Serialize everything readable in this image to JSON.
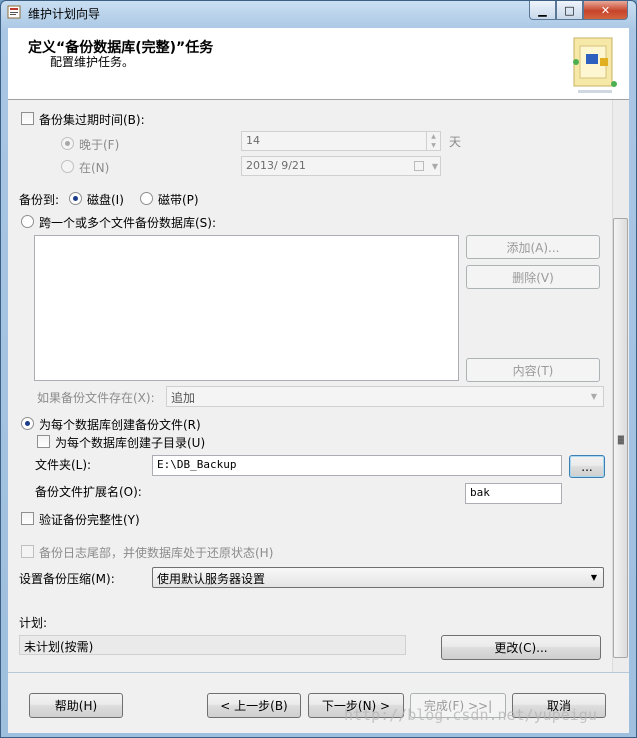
{
  "window": {
    "title": "维护计划向导"
  },
  "header": {
    "title": "定义“备份数据库(完整)”任务",
    "subtitle": "配置维护任务。"
  },
  "expire": {
    "label": "备份集过期时间(B):",
    "after_label": "晚于(F)",
    "after_value": "14",
    "after_unit": "天",
    "on_label": "在(N)",
    "on_value": "2013/ 9/21"
  },
  "backup_to": {
    "label": "备份到:",
    "disk_label": "磁盘(I)",
    "tape_label": "磁带(P)"
  },
  "span_files": {
    "label": "跨一个或多个文件备份数据库(S):",
    "add_label": "添加(A)...",
    "remove_label": "删除(V)",
    "contents_label": "内容(T)",
    "if_exists_label": "如果备份文件存在(X):",
    "if_exists_value": "追加"
  },
  "per_db": {
    "label": "为每个数据库创建备份文件(R)",
    "subdir_label": "为每个数据库创建子目录(U)",
    "folder_label": "文件夹(L):",
    "folder_value": "E:\\DB_Backup",
    "browse_label": "...",
    "ext_label": "备份文件扩展名(O):",
    "ext_value": "bak"
  },
  "verify": {
    "label": "验证备份完整性(Y)"
  },
  "tail_log": {
    "label": "备份日志尾部，并使数据库处于还原状态(H)"
  },
  "compression": {
    "label": "设置备份压缩(M):",
    "value": "使用默认服务器设置"
  },
  "schedule": {
    "label": "计划:",
    "value": "未计划(按需)",
    "change_label": "更改(C)..."
  },
  "footer": {
    "help_label": "帮助(H)",
    "back_label": "< 上一步(B)",
    "next_label": "下一步(N) >",
    "finish_label": "完成(F) >>|",
    "cancel_label": "取消"
  },
  "watermark": "http://blog.csdn.net/yupeigu"
}
